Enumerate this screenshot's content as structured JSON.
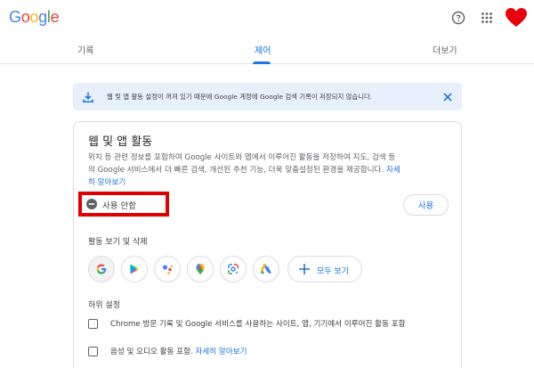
{
  "header": {
    "logo_letters": [
      {
        "ch": "G",
        "color": "#4285f4"
      },
      {
        "ch": "o",
        "color": "#ea4335"
      },
      {
        "ch": "o",
        "color": "#fbbc05"
      },
      {
        "ch": "g",
        "color": "#4285f4"
      },
      {
        "ch": "l",
        "color": "#34a853"
      },
      {
        "ch": "e",
        "color": "#ea4335"
      }
    ],
    "icons": [
      "help-icon",
      "apps-grid-icon",
      "heart-avatar-icon"
    ]
  },
  "tabs": [
    {
      "label": "기록",
      "active": false
    },
    {
      "label": "제어",
      "active": true
    },
    {
      "label": "더보기",
      "active": false
    }
  ],
  "banner": {
    "text": "웹 및 앱 활동 설정이 꺼져 있기 때문에 Google 계정에 Google 검색 기록이 저장되지 않습니다."
  },
  "card": {
    "title": "웹 및 앱 활동",
    "desc_line1": "위치 등 관련 정보를 포함하여 Google 사이트와 앱에서 이루어진 활동을 저장하여 지도, 검색 등",
    "desc_line2": "의 Google 서비스에서 더 빠른 검색, 개선된 추천 기능, 더욱 맞춤설정된 환경을 제공합니다.",
    "desc_link_a": "자세",
    "desc_link_b": "히 알아보기",
    "status_label": "사용 안함",
    "use_button": "사용",
    "activity_section": "활동 보기 및 삭제",
    "apps": [
      "google-g-icon",
      "play-store-icon",
      "assistant-icon",
      "maps-icon",
      "lens-icon",
      "ads-icon"
    ],
    "all_button": "모두 보기",
    "sub_settings": "하위 설정",
    "check1": "Chrome 방문 기록 및 Google 서비스를 사용하는 사이트, 앱, 기기에서 이루어진 활동 포함",
    "check2_text": "음성 및 오디오 활동 포함.",
    "check2_link": "자세히 알아보기"
  },
  "colors": {
    "accent": "#1a73e8",
    "banner_bg": "#e8f0fe",
    "highlight_box": "#e00000",
    "avatar_heart": "#e8000b"
  }
}
